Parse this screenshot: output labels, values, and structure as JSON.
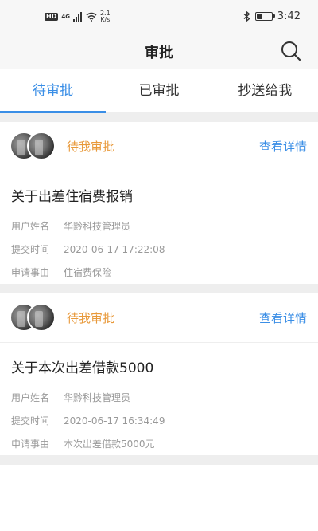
{
  "status_bar": {
    "hd": "HD",
    "network": "4G",
    "speed_value": "2.1",
    "speed_unit": "K/s",
    "time": "3:42",
    "battery_level": 0.35
  },
  "header": {
    "title": "审批"
  },
  "tabs": [
    {
      "label": "待审批",
      "active": true
    },
    {
      "label": "已审批",
      "active": false
    },
    {
      "label": "抄送给我",
      "active": false
    }
  ],
  "cards": [
    {
      "status": "待我审批",
      "detail_link": "查看详情",
      "title": "关于出差住宿费报销",
      "fields": [
        {
          "label": "用户姓名",
          "value": "华黔科技管理员"
        },
        {
          "label": "提交时间",
          "value": "2020-06-17 17:22:08"
        },
        {
          "label": "申请事由",
          "value": "住宿费保险"
        }
      ]
    },
    {
      "status": "待我审批",
      "detail_link": "查看详情",
      "title": "关于本次出差借款5000",
      "fields": [
        {
          "label": "用户姓名",
          "value": "华黔科技管理员"
        },
        {
          "label": "提交时间",
          "value": "2020-06-17 16:34:49"
        },
        {
          "label": "申请事由",
          "value": "本次出差借款5000元"
        }
      ]
    }
  ],
  "colors": {
    "accent": "#3a8ee6",
    "status_orange": "#e8993a"
  }
}
